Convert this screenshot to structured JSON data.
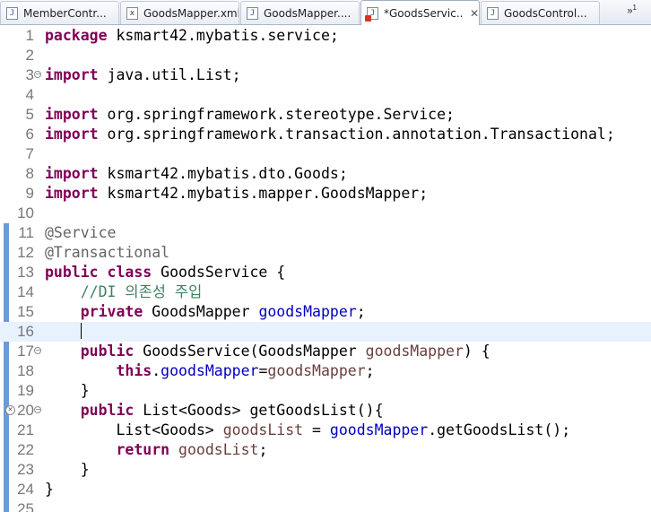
{
  "tabs": [
    {
      "label": "MemberContr...",
      "icon": "java-file-icon"
    },
    {
      "label": "GoodsMapper.xml",
      "icon": "xml-file-icon"
    },
    {
      "label": "GoodsMapper....",
      "icon": "java-file-icon"
    },
    {
      "label": "*GoodsServic...",
      "icon": "java-file-error-icon",
      "active": true,
      "close": "✕"
    },
    {
      "label": "GoodsControl...",
      "icon": "java-file-icon"
    }
  ],
  "tab_overflow": {
    "symbol": "»",
    "count": "1"
  },
  "editor": {
    "current_line": 16,
    "lines": [
      {
        "n": "1",
        "segs": [
          {
            "t": "package",
            "c": "kw"
          },
          {
            "t": " ksmart42.mybatis.service;",
            "c": "txt"
          }
        ]
      },
      {
        "n": "2",
        "segs": []
      },
      {
        "n": "3",
        "fold": "−",
        "segs": [
          {
            "t": "import",
            "c": "kw"
          },
          {
            "t": " java.util.List;",
            "c": "txt"
          }
        ]
      },
      {
        "n": "4",
        "segs": []
      },
      {
        "n": "5",
        "segs": [
          {
            "t": "import",
            "c": "kw"
          },
          {
            "t": " org.springframework.stereotype.Service;",
            "c": "txt"
          }
        ]
      },
      {
        "n": "6",
        "segs": [
          {
            "t": "import",
            "c": "kw"
          },
          {
            "t": " org.springframework.transaction.annotation.Transactional;",
            "c": "txt"
          }
        ]
      },
      {
        "n": "7",
        "segs": []
      },
      {
        "n": "8",
        "segs": [
          {
            "t": "import",
            "c": "kw"
          },
          {
            "t": " ksmart42.mybatis.dto.Goods;",
            "c": "txt"
          }
        ]
      },
      {
        "n": "9",
        "segs": [
          {
            "t": "import",
            "c": "kw"
          },
          {
            "t": " ksmart42.mybatis.mapper.GoodsMapper;",
            "c": "txt"
          }
        ]
      },
      {
        "n": "10",
        "segs": []
      },
      {
        "n": "11",
        "segs": [
          {
            "t": "@Service",
            "c": "ann"
          }
        ]
      },
      {
        "n": "12",
        "segs": [
          {
            "t": "@Transactional",
            "c": "ann"
          }
        ]
      },
      {
        "n": "13",
        "segs": [
          {
            "t": "public",
            "c": "kw"
          },
          {
            "t": " ",
            "c": "txt"
          },
          {
            "t": "class",
            "c": "kw"
          },
          {
            "t": " GoodsService {",
            "c": "txt"
          }
        ]
      },
      {
        "n": "14",
        "segs": [
          {
            "t": "    ",
            "c": "txt"
          },
          {
            "t": "//DI 의존성 주입",
            "c": "cmt"
          }
        ]
      },
      {
        "n": "15",
        "segs": [
          {
            "t": "    ",
            "c": "txt"
          },
          {
            "t": "private",
            "c": "kw"
          },
          {
            "t": " GoodsMapper ",
            "c": "txt"
          },
          {
            "t": "goodsMapper",
            "c": "fld"
          },
          {
            "t": ";",
            "c": "txt"
          }
        ]
      },
      {
        "n": "16",
        "segs": [
          {
            "t": "    ",
            "c": "txt"
          },
          {
            "t": "",
            "c": "caret"
          }
        ]
      },
      {
        "n": "17",
        "fold": "−",
        "segs": [
          {
            "t": "    ",
            "c": "txt"
          },
          {
            "t": "public",
            "c": "kw"
          },
          {
            "t": " GoodsService(GoodsMapper ",
            "c": "txt"
          },
          {
            "t": "goodsMapper",
            "c": "var"
          },
          {
            "t": ") {",
            "c": "txt"
          }
        ]
      },
      {
        "n": "18",
        "segs": [
          {
            "t": "        ",
            "c": "txt"
          },
          {
            "t": "this",
            "c": "kw"
          },
          {
            "t": ".",
            "c": "txt"
          },
          {
            "t": "goodsMapper",
            "c": "fld"
          },
          {
            "t": "=",
            "c": "txt"
          },
          {
            "t": "goodsMapper",
            "c": "var"
          },
          {
            "t": ";",
            "c": "txt"
          }
        ]
      },
      {
        "n": "19",
        "segs": [
          {
            "t": "    }",
            "c": "txt"
          }
        ]
      },
      {
        "n": "20",
        "fold": "−",
        "warn": true,
        "segs": [
          {
            "t": "    ",
            "c": "txt"
          },
          {
            "t": "public",
            "c": "kw"
          },
          {
            "t": " List<Goods> getGoodsList(){",
            "c": "txt"
          }
        ]
      },
      {
        "n": "21",
        "segs": [
          {
            "t": "        List<Goods> ",
            "c": "txt"
          },
          {
            "t": "goodsList",
            "c": "var"
          },
          {
            "t": " = ",
            "c": "txt"
          },
          {
            "t": "goodsMapper",
            "c": "fld"
          },
          {
            "t": ".getGoodsList();",
            "c": "txt"
          }
        ]
      },
      {
        "n": "22",
        "segs": [
          {
            "t": "        ",
            "c": "txt"
          },
          {
            "t": "return",
            "c": "kw"
          },
          {
            "t": " ",
            "c": "txt"
          },
          {
            "t": "goodsList",
            "c": "var"
          },
          {
            "t": ";",
            "c": "txt"
          }
        ]
      },
      {
        "n": "23",
        "segs": [
          {
            "t": "    }",
            "c": "txt"
          }
        ]
      },
      {
        "n": "24",
        "segs": [
          {
            "t": "}",
            "c": "txt"
          }
        ]
      },
      {
        "n": "25",
        "segs": []
      }
    ],
    "change_ruler_lines": [
      11,
      12,
      13,
      14,
      15,
      16,
      17,
      18,
      19,
      20,
      21,
      22,
      23,
      24,
      25
    ]
  }
}
